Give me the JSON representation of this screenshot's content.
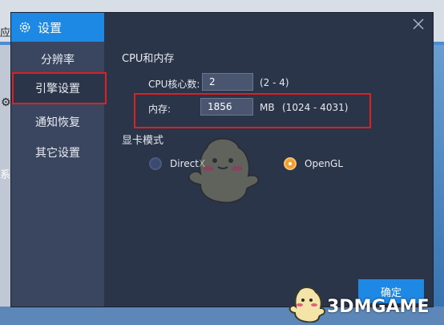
{
  "background": {
    "edge_text_top": "应月",
    "edge_text_mid": "系"
  },
  "sidebar": {
    "header_title": "设置",
    "items": [
      {
        "label": "分辨率"
      },
      {
        "label": "引擎设置"
      },
      {
        "label": "通知恢复"
      },
      {
        "label": "其它设置"
      }
    ]
  },
  "cpu_section": {
    "title": "CPU和内存",
    "cores_label": "CPU核心数:",
    "cores_value": "2",
    "cores_range": "(2 - 4)",
    "memory_label": "内存:",
    "memory_value": "1856",
    "memory_unit": "MB",
    "memory_range": "(1024 - 4031)"
  },
  "gpu_section": {
    "title": "显卡模式",
    "option_directx": "DirectX",
    "option_opengl": "OpenGL",
    "selected": "OpenGL"
  },
  "footer": {
    "ok_label": "确定"
  },
  "watermark": {
    "text": "3DMGAME"
  },
  "colors": {
    "accent": "#1e88e5",
    "highlight": "#e02020",
    "radio_selected": "#f0a030"
  }
}
